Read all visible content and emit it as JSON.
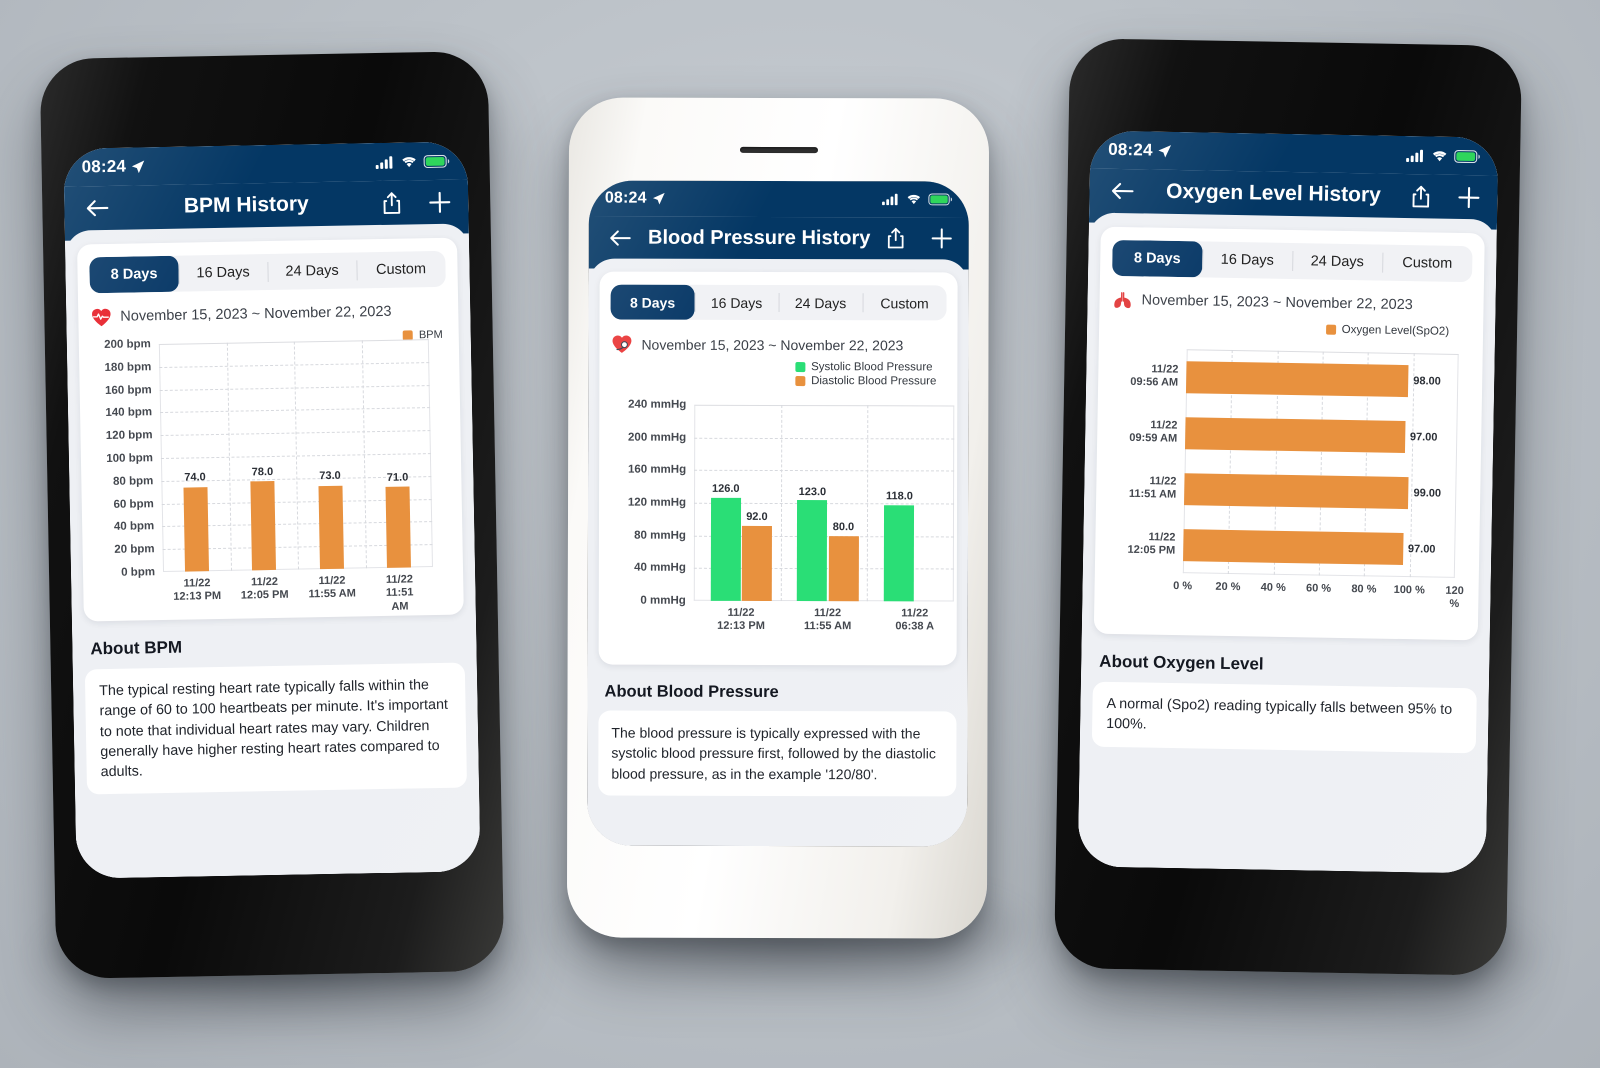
{
  "background": {
    "color": "#bcc2c8"
  },
  "theme": {
    "navy": "#043764",
    "orange": "#e8913e",
    "green": "#2ade76",
    "card": "#ffffff",
    "sheet": "#eef0f4"
  },
  "phones": [
    {
      "id": "bpm",
      "frame": "dark",
      "status": {
        "time": "08:24",
        "location_icon": "location-arrow-icon",
        "cellular_icon": "cellular-bars-icon",
        "wifi_icon": "wifi-icon",
        "battery_icon": "battery-full-icon"
      },
      "nav": {
        "back_icon": "back-arrow-icon",
        "title": "BPM History",
        "share_icon": "share-icon",
        "add_icon": "plus-icon"
      },
      "segments": [
        {
          "label": "8 Days",
          "active": true
        },
        {
          "label": "16 Days",
          "active": false
        },
        {
          "label": "24 Days",
          "active": false
        },
        {
          "label": "Custom",
          "active": false
        }
      ],
      "date_range": {
        "icon": "heartbeat-icon",
        "text": "November 15, 2023 ~ November 22, 2023"
      },
      "about": {
        "heading": "About BPM",
        "body": "The typical resting heart rate typically falls within the range of 60 to 100 heartbeats per minute. It's important to note that individual heart rates may vary. Children generally have higher resting heart rates compared to adults."
      },
      "chart_data": {
        "type": "bar",
        "orientation": "vertical",
        "title": "",
        "xlabel": "",
        "ylabel": "bpm",
        "ylim": [
          0,
          200
        ],
        "yticks": [
          0,
          20,
          40,
          60,
          80,
          100,
          120,
          140,
          160,
          180,
          200
        ],
        "ytick_labels": [
          "0 bpm",
          "20 bpm",
          "40 bpm",
          "60 bpm",
          "80 bpm",
          "100 bpm",
          "120 bpm",
          "140 bpm",
          "160 bpm",
          "180 bpm",
          "200 bpm"
        ],
        "grid": true,
        "legend": {
          "position": "top-right",
          "entries": [
            {
              "name": "BPM",
              "color": "#e8913e"
            }
          ]
        },
        "categories": [
          "11/22\n12:13 PM",
          "11/22\n12:05 PM",
          "11/22\n11:55 AM",
          "11/22\n11:51 AM"
        ],
        "category_lines": [
          [
            "11/22",
            "12:13 PM"
          ],
          [
            "11/22",
            "12:05 PM"
          ],
          [
            "11/22",
            "11:55 AM"
          ],
          [
            "11/22",
            "11:51 AM"
          ]
        ],
        "series": [
          {
            "name": "BPM",
            "color": "#e8913e",
            "values": [
              74.0,
              78.0,
              73.0,
              71.0
            ],
            "data_labels": [
              "74.0",
              "78.0",
              "73.0",
              "71.0"
            ]
          }
        ]
      }
    },
    {
      "id": "bp",
      "frame": "light",
      "status": {
        "time": "08:24",
        "location_icon": "location-arrow-icon",
        "cellular_icon": "cellular-bars-icon",
        "wifi_icon": "wifi-icon",
        "battery_icon": "battery-full-icon"
      },
      "nav": {
        "back_icon": "back-arrow-icon",
        "title": "Blood Pressure History",
        "share_icon": "share-icon",
        "add_icon": "plus-icon"
      },
      "segments": [
        {
          "label": "8 Days",
          "active": true
        },
        {
          "label": "16 Days",
          "active": false
        },
        {
          "label": "24 Days",
          "active": false
        },
        {
          "label": "Custom",
          "active": false
        }
      ],
      "date_range": {
        "icon": "blood-pressure-monitor-icon",
        "text": "November 15, 2023 ~ November 22, 2023"
      },
      "about": {
        "heading": "About Blood Pressure",
        "body": "The blood pressure is typically expressed with the systolic blood pressure first, followed by the diastolic blood pressure, as in the example '120/80'."
      },
      "chart_data": {
        "type": "bar",
        "orientation": "vertical",
        "title": "",
        "xlabel": "",
        "ylabel": "mmHg",
        "ylim": [
          0,
          240
        ],
        "yticks": [
          0,
          40,
          80,
          120,
          160,
          200,
          240
        ],
        "ytick_labels": [
          "0 mmHg",
          "40 mmHg",
          "80 mmHg",
          "120 mmHg",
          "160 mmHg",
          "200 mmHg",
          "240 mmHg"
        ],
        "grid": true,
        "legend": {
          "position": "top-right",
          "entries": [
            {
              "name": "Systolic Blood Pressure",
              "color": "#2ade76"
            },
            {
              "name": "Diastolic Blood Pressure",
              "color": "#e8913e"
            }
          ]
        },
        "categories": [
          "11/22 12:13 PM",
          "11/22 11:55 AM",
          "11/22 06:38 A"
        ],
        "category_lines": [
          [
            "11/22",
            "12:13 PM"
          ],
          [
            "11/22",
            "11:55 AM"
          ],
          [
            "11/22",
            "06:38 A"
          ]
        ],
        "series": [
          {
            "name": "Systolic Blood Pressure",
            "color": "#2ade76",
            "values": [
              126.0,
              123.0,
              118.0
            ],
            "data_labels": [
              "126.0",
              "123.0",
              "118.0"
            ]
          },
          {
            "name": "Diastolic Blood Pressure",
            "color": "#e8913e",
            "values": [
              92.0,
              80.0,
              null
            ],
            "data_labels": [
              "92.0",
              "80.0",
              ""
            ]
          }
        ]
      }
    },
    {
      "id": "spo2",
      "frame": "dark",
      "status": {
        "time": "08:24",
        "location_icon": "location-arrow-icon",
        "cellular_icon": "cellular-bars-icon",
        "wifi_icon": "wifi-icon",
        "battery_icon": "battery-full-icon"
      },
      "nav": {
        "back_icon": "back-arrow-icon",
        "title": "Oxygen Level History",
        "share_icon": "share-icon",
        "add_icon": "plus-icon"
      },
      "segments": [
        {
          "label": "8 Days",
          "active": true
        },
        {
          "label": "16 Days",
          "active": false
        },
        {
          "label": "24 Days",
          "active": false
        },
        {
          "label": "Custom",
          "active": false
        }
      ],
      "date_range": {
        "icon": "lungs-icon",
        "text": "November 15, 2023 ~ November 22, 2023"
      },
      "about": {
        "heading": "About Oxygen Level",
        "body": "A normal (Spo2) reading typically falls between 95% to 100%."
      },
      "chart_data": {
        "type": "bar",
        "orientation": "horizontal",
        "title": "",
        "xlabel": "%",
        "ylabel": "",
        "xlim": [
          0,
          120
        ],
        "xticks": [
          0,
          20,
          40,
          60,
          80,
          100,
          120
        ],
        "xtick_labels": [
          "0 %",
          "20 %",
          "40 %",
          "60 %",
          "80 %",
          "100 %",
          "120 %"
        ],
        "grid": true,
        "legend": {
          "position": "top-right",
          "entries": [
            {
              "name": "Oxygen Level(SpO2)",
              "color": "#e8913e"
            }
          ]
        },
        "categories": [
          "11/22 09:56 AM",
          "11/22 09:59 AM",
          "11/22 11:51 AM",
          "11/22 12:05 PM"
        ],
        "category_lines": [
          [
            "11/22",
            "09:56 AM"
          ],
          [
            "11/22",
            "09:59 AM"
          ],
          [
            "11/22",
            "11:51 AM"
          ],
          [
            "11/22",
            "12:05 PM"
          ]
        ],
        "series": [
          {
            "name": "Oxygen Level(SpO2)",
            "color": "#e8913e",
            "values": [
              98.0,
              97.0,
              99.0,
              97.0
            ],
            "data_labels": [
              "98.00",
              "97.00",
              "99.00",
              "97.00"
            ]
          }
        ]
      }
    }
  ]
}
